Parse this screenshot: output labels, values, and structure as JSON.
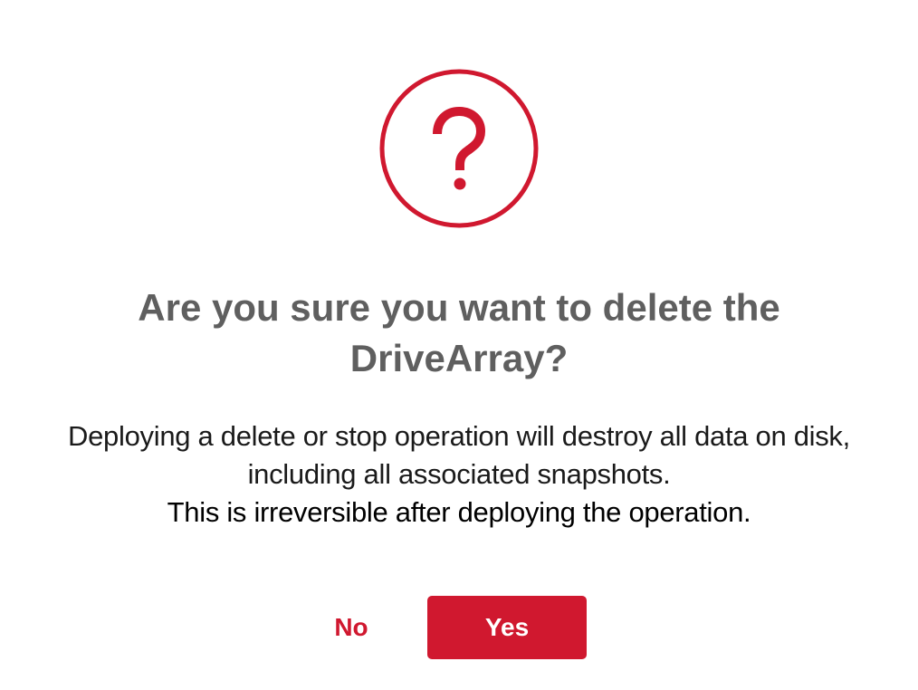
{
  "dialog": {
    "icon": "question-mark-circle-icon",
    "accent_color": "#d0182f",
    "title": "Are you sure you want to delete the DriveArray?",
    "message_line_1": "Deploying a delete or stop operation will destroy all data on disk, including all associated snapshots.",
    "message_line_2": "This is irreversible after deploying the operation.",
    "no_label": "No",
    "yes_label": "Yes"
  }
}
